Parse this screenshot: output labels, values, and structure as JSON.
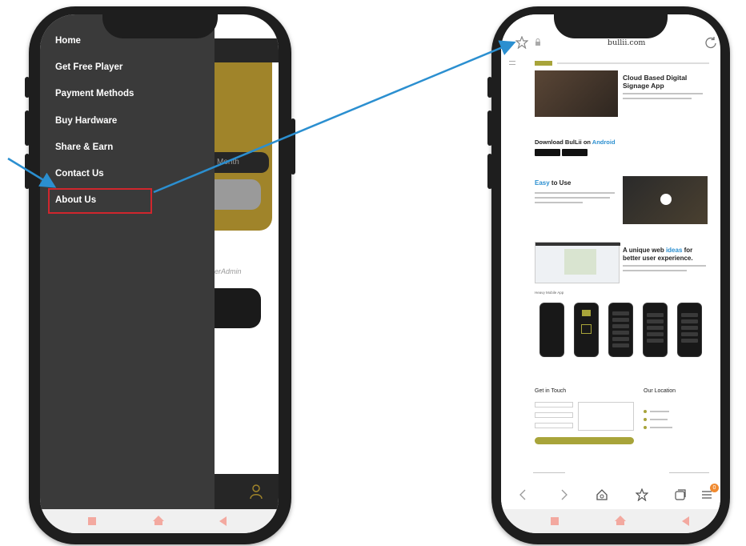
{
  "left_phone": {
    "menu": [
      {
        "label": "Home"
      },
      {
        "label": "Get Free Player"
      },
      {
        "label": "Payment Methods"
      },
      {
        "label": "Buy Hardware"
      },
      {
        "label": "Share & Earn"
      },
      {
        "label": "Contact Us"
      },
      {
        "label": "About Us"
      }
    ],
    "background_month_label": "Month",
    "background_role_label": "erAdmin"
  },
  "right_phone": {
    "url": "bullii.com",
    "hero_title_line1": "Cloud Based Digital",
    "hero_title_line2": "Signage App",
    "download_prefix": "Download BulLii on ",
    "download_platform": "Android",
    "easy_word": "Easy",
    "easy_suffix": " to Use",
    "unique_line1_a": "A unique web ",
    "unique_line1_b": "ideas",
    "unique_line1_c": " for",
    "unique_line2": "better user experience.",
    "mobile_app_label": "Heavy Mobile App",
    "get_in_touch": "Get in Touch",
    "our_location": "Our Location",
    "badge_count": "0"
  },
  "colors": {
    "accent_blue": "#2b8fd0",
    "highlight_red": "#d0262d",
    "gold": "#a0842a",
    "drawer": "#3a3a3a",
    "olive": "#a8a43a"
  },
  "icons": [
    "star-icon",
    "lock-icon",
    "refresh-icon",
    "back-arrow-icon",
    "forward-arrow-icon",
    "home-icon",
    "bookmark-star-icon",
    "tabs-icon",
    "menu-icon",
    "person-icon"
  ]
}
